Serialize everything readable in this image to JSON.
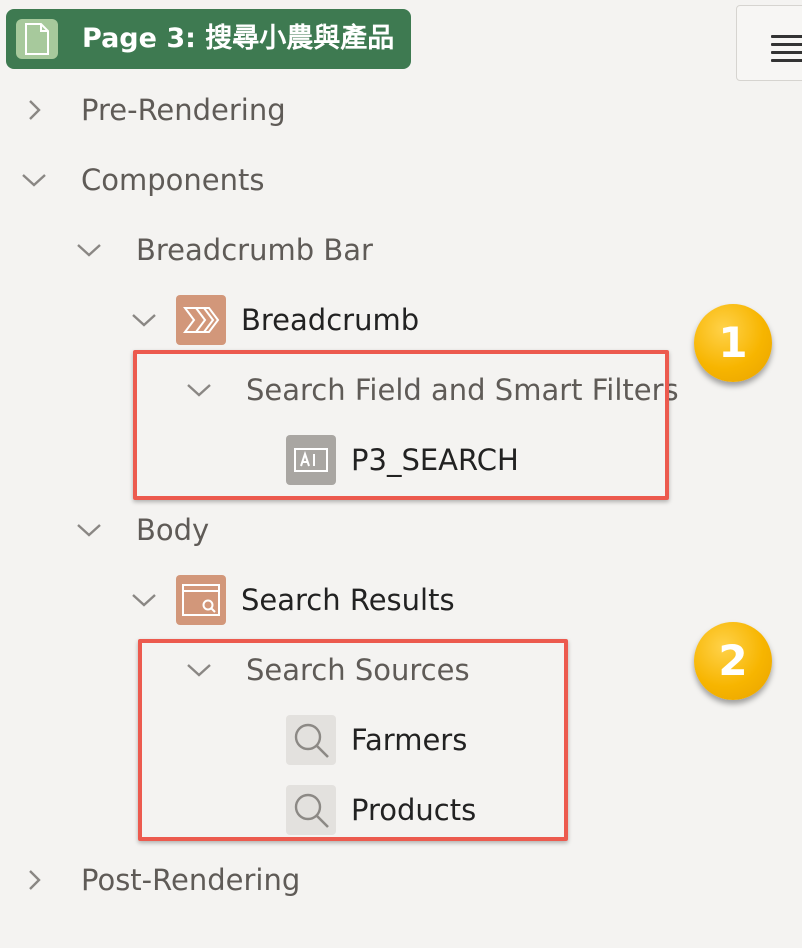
{
  "page": {
    "title": "Page 3: 搜尋小農與產品"
  },
  "tree": {
    "pre_rendering": "Pre-Rendering",
    "components": "Components",
    "breadcrumb_bar": "Breadcrumb Bar",
    "breadcrumb": "Breadcrumb",
    "search_field": "Search Field and Smart Filters",
    "p3_search": "P3_SEARCH",
    "body": "Body",
    "search_results": "Search Results",
    "search_sources": "Search Sources",
    "farmers": "Farmers",
    "products": "Products",
    "post_rendering": "Post-Rendering"
  },
  "badges": {
    "one": "1",
    "two": "2"
  },
  "icons": {
    "page": "page-icon",
    "menu": "hamburger-icon",
    "breadcrumb": "breadcrumb-icon",
    "item": "text-field-icon",
    "region": "search-region-icon",
    "source": "magnifier-icon"
  },
  "colors": {
    "page_pill": "#3e7a51",
    "orange_icon": "#d2977a",
    "highlight": "#ec5a4e",
    "badge": "#f7b500"
  }
}
